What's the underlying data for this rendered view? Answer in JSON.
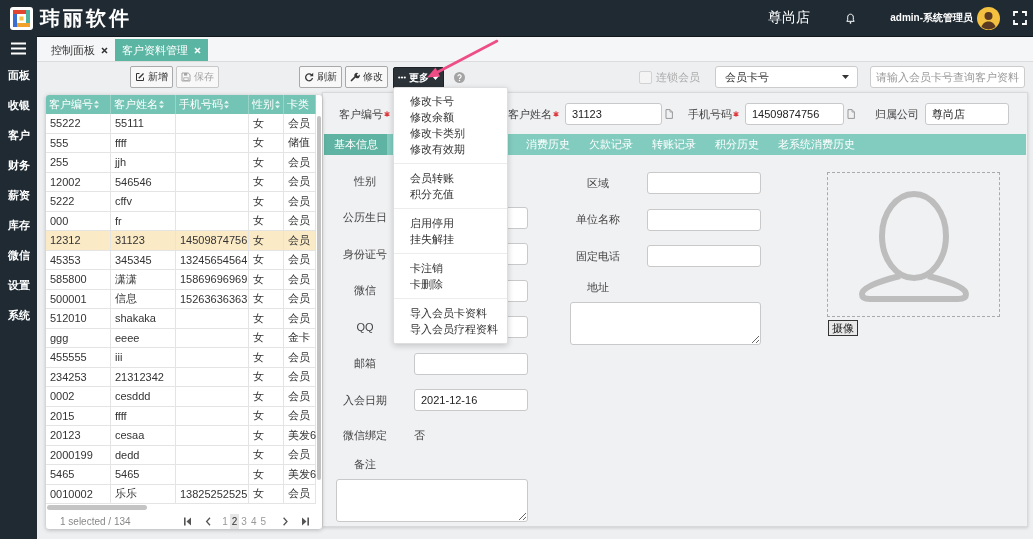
{
  "topbar": {
    "brand": "玮丽软件",
    "store": "尊尚店",
    "user": "admin-系统管理员"
  },
  "sidebar": {
    "items": [
      "面板",
      "收银",
      "客户",
      "财务",
      "薪资",
      "库存",
      "微信",
      "设置",
      "系统"
    ]
  },
  "tabs": [
    {
      "label": "控制面板",
      "selected": false
    },
    {
      "label": "客户资料管理",
      "selected": true
    }
  ],
  "toolbar": {
    "buttons": [
      {
        "kind": "add",
        "label": "新增",
        "disabled": false
      },
      {
        "kind": "save",
        "label": "保存",
        "disabled": true
      },
      {
        "kind": "refresh",
        "label": "刷新",
        "disabled": false
      },
      {
        "kind": "edit",
        "label": "修改",
        "disabled": false
      }
    ],
    "more": {
      "label": "更多",
      "expanded": true,
      "menu": [
        [
          "修改卡号",
          "修改余额",
          "修改卡类别",
          "修改有效期"
        ],
        [
          "会员转账",
          "积分充值"
        ],
        [
          "启用停用",
          "挂失解挂"
        ],
        [
          "卡注销",
          "卡删除"
        ],
        [
          "导入会员卡资料",
          "导入会员疗程资料"
        ]
      ]
    },
    "chain_member": {
      "label": "连锁会员",
      "checked": false,
      "disabled": true
    },
    "search_by": {
      "value": "会员卡号"
    },
    "search": {
      "placeholder": "请输入会员卡号查询客户资料"
    }
  },
  "table": {
    "columns": [
      {
        "label": "客户编号",
        "sortable": true
      },
      {
        "label": "客户姓名",
        "sortable": true
      },
      {
        "label": "手机号码",
        "sortable": true
      },
      {
        "label": "性别",
        "sortable": true
      },
      {
        "label": "卡类",
        "sortable": false
      }
    ],
    "rows": [
      {
        "cells": [
          "55222",
          "55111",
          null,
          "女",
          "会员"
        ],
        "selected": false
      },
      {
        "cells": [
          "555",
          "ffff",
          null,
          "女",
          "储值"
        ],
        "selected": false
      },
      {
        "cells": [
          "255",
          "jjh",
          null,
          "女",
          "会员"
        ],
        "selected": false
      },
      {
        "cells": [
          "12002",
          "546546",
          null,
          "女",
          "会员"
        ],
        "selected": false
      },
      {
        "cells": [
          "5222",
          "cffv",
          null,
          "女",
          "会员"
        ],
        "selected": false
      },
      {
        "cells": [
          "000",
          "fr",
          null,
          "女",
          "会员"
        ],
        "selected": false
      },
      {
        "cells": [
          "12312",
          "31123",
          "14509874756",
          "女",
          "会员"
        ],
        "selected": true
      },
      {
        "cells": [
          "45353",
          "345345",
          "13245654564",
          "女",
          "会员"
        ],
        "selected": false
      },
      {
        "cells": [
          "585800",
          "潇潇",
          "15869696969",
          "女",
          "会员"
        ],
        "selected": false
      },
      {
        "cells": [
          "500001",
          "信息",
          "15263636363",
          "女",
          "会员"
        ],
        "selected": false
      },
      {
        "cells": [
          "512010",
          "shakaka",
          null,
          "女",
          "会员"
        ],
        "selected": false
      },
      {
        "cells": [
          "ggg",
          "eeee",
          null,
          "女",
          "金卡"
        ],
        "selected": false
      },
      {
        "cells": [
          "455555",
          "iii",
          null,
          "女",
          "会员"
        ],
        "selected": false
      },
      {
        "cells": [
          "234253",
          "21312342",
          null,
          "女",
          "会员"
        ],
        "selected": false
      },
      {
        "cells": [
          "0002",
          "cesddd",
          null,
          "女",
          "会员"
        ],
        "selected": false
      },
      {
        "cells": [
          "2015",
          "ffff",
          null,
          "女",
          "会员"
        ],
        "selected": false
      },
      {
        "cells": [
          "20123",
          "cesaa",
          null,
          "女",
          "美发6"
        ],
        "selected": false
      },
      {
        "cells": [
          "2000199",
          "dedd",
          null,
          "女",
          "会员"
        ],
        "selected": false
      },
      {
        "cells": [
          "5465",
          "5465",
          null,
          "女",
          "美发6"
        ],
        "selected": false
      },
      {
        "cells": [
          "0010002",
          "乐乐",
          "13825252525",
          "女",
          "会员"
        ],
        "selected": false
      }
    ],
    "footer": {
      "summary": "1 selected / 134",
      "pages": [
        {
          "label": "1",
          "selected": false
        },
        {
          "label": "2",
          "selected": true
        },
        {
          "label": "3",
          "selected": false
        },
        {
          "label": "4",
          "selected": false
        },
        {
          "label": "5",
          "selected": false
        }
      ]
    }
  },
  "detail": {
    "header_fields": [
      {
        "label": "客户编号",
        "required": true
      },
      {
        "label": "客户姓名",
        "required": true,
        "value": "31123",
        "copy": true
      },
      {
        "label": "手机号码",
        "required": true,
        "value": "14509874756",
        "copy": true
      },
      {
        "label": "归属公司",
        "required": false,
        "value": "尊尚店",
        "copy": false
      }
    ],
    "tabs": [
      {
        "label": "基本信息",
        "selected": true
      },
      {
        "label": "消费历史",
        "selected": false
      },
      {
        "label": "欠款记录",
        "selected": false
      },
      {
        "label": "转账记录",
        "selected": false
      },
      {
        "label": "积分历史",
        "selected": false
      },
      {
        "label": "老系统消费历史",
        "selected": false
      }
    ],
    "form_left": [
      {
        "label": "性别",
        "kind": "blank"
      },
      {
        "label": "公历生日",
        "kind": "input"
      },
      {
        "label": "身份证号",
        "kind": "input"
      },
      {
        "label": "微信",
        "kind": "input"
      },
      {
        "label": "QQ",
        "kind": "input"
      },
      {
        "label": "邮箱",
        "kind": "input"
      },
      {
        "label": "入会日期",
        "kind": "input",
        "value": "2021-12-16"
      },
      {
        "label": "微信绑定",
        "kind": "text",
        "value": "否"
      },
      {
        "label": "备注",
        "kind": "textarea"
      }
    ],
    "form_middle": [
      {
        "label": "区域",
        "kind": "input"
      },
      {
        "label": "单位名称",
        "kind": "input"
      },
      {
        "label": "固定电话",
        "kind": "input"
      },
      {
        "label": "地址",
        "kind": "textarea"
      }
    ],
    "photo": {
      "button": "摄像"
    }
  }
}
